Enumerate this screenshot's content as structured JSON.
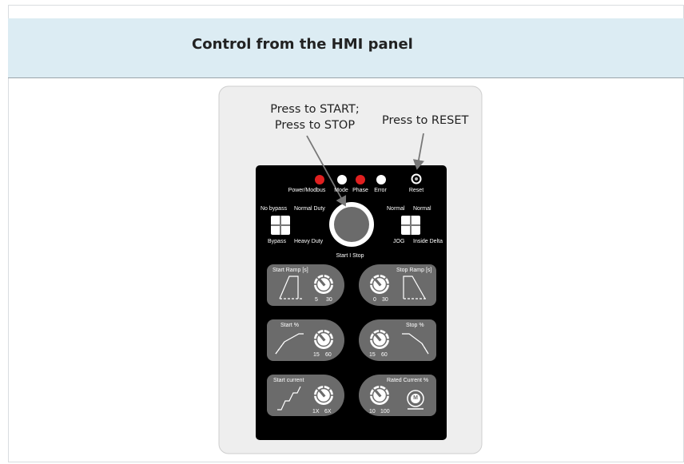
{
  "header": {
    "title": "Control from the HMI panel"
  },
  "callouts": {
    "start_line1": "Press to START;",
    "start_line2": "Press to STOP",
    "reset": "Press to RESET"
  },
  "panel": {
    "leds": [
      {
        "label": "Power/Modbus",
        "color": "#e02020"
      },
      {
        "label": "Mode",
        "color": "#ffffff"
      },
      {
        "label": "Phase",
        "color": "#e02020"
      },
      {
        "label": "Error",
        "color": "#ffffff"
      }
    ],
    "reset_label": "Reset",
    "start_stop_label": "Start I Stop",
    "left_switch": {
      "top_left": "No bypass",
      "top_right": "Normal Duty",
      "bottom_left": "Bypass",
      "bottom_right": "Heavy Duty"
    },
    "right_switch": {
      "top_left": "Normal",
      "top_right": "Normal",
      "bottom_left": "JOG",
      "bottom_right": "Inside Delta"
    },
    "modules": {
      "start_ramp": {
        "label": "Start Ramp [s]",
        "min": "5",
        "max": "30"
      },
      "stop_ramp": {
        "label": "Stop Ramp [s]",
        "min": "0",
        "max": "30"
      },
      "start_pct": {
        "label": "Start %",
        "min": "15",
        "max": "60"
      },
      "stop_pct": {
        "label": "Stop %",
        "min": "15",
        "max": "60"
      },
      "start_current": {
        "label": "Start current",
        "min": "1X",
        "max": "6X"
      },
      "rated_current": {
        "label": "Rated Current %",
        "min": "10",
        "max": "100"
      }
    },
    "motor_symbol": "M"
  },
  "colors": {
    "header_bg": "#dcecf3",
    "panel_bg": "#000000",
    "module_bg": "#6b6b6b",
    "led_red": "#e02020"
  }
}
